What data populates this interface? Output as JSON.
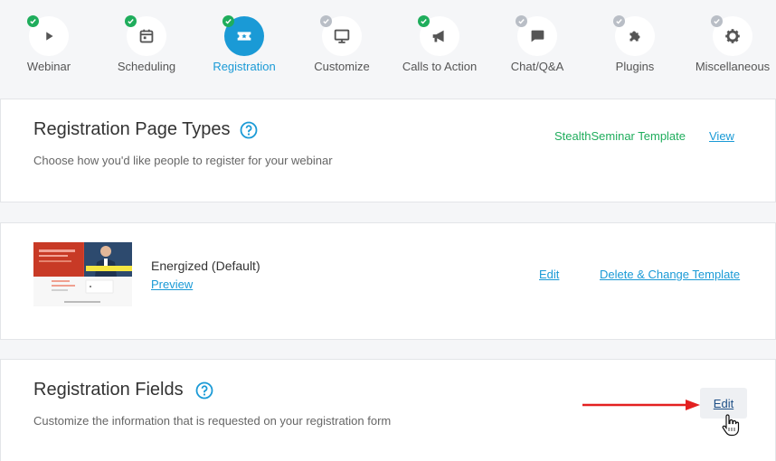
{
  "stepper": {
    "steps": [
      {
        "label": "Webinar",
        "icon": "play-icon",
        "status": "complete"
      },
      {
        "label": "Scheduling",
        "icon": "calendar-icon",
        "status": "complete"
      },
      {
        "label": "Registration",
        "icon": "ticket-icon",
        "status": "active"
      },
      {
        "label": "Customize",
        "icon": "monitor-icon",
        "status": "pending"
      },
      {
        "label": "Calls to Action",
        "icon": "megaphone-icon",
        "status": "complete"
      },
      {
        "label": "Chat/Q&A",
        "icon": "chat-icon",
        "status": "pending"
      },
      {
        "label": "Plugins",
        "icon": "puzzle-icon",
        "status": "pending"
      },
      {
        "label": "Miscellaneous",
        "icon": "gear-icon",
        "status": "pending"
      }
    ],
    "colors": {
      "active": "#1a9ad6",
      "complete_check": "#1fad5c",
      "pending_check": "#b9bec6"
    }
  },
  "page_types": {
    "title": "Registration Page Types",
    "subtitle": "Choose how you'd like people to register for your webinar",
    "template_label": "StealthSeminar Template",
    "view_link": "View"
  },
  "template": {
    "name": "Energized (Default)",
    "preview_link": "Preview",
    "edit_link": "Edit",
    "delete_link": "Delete & Change Template"
  },
  "fields": {
    "title": "Registration Fields",
    "subtitle": "Customize the information that is requested on your registration form",
    "edit_button": "Edit"
  }
}
